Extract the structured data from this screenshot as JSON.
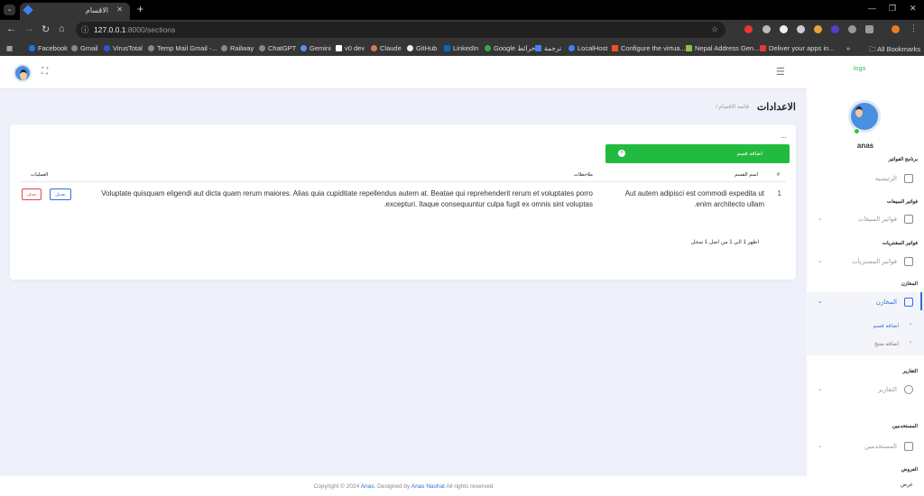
{
  "browser": {
    "tab_title": "الاقسام",
    "url_host": "127.0.0.1",
    "url_path": ":8000/sections",
    "bookmarks": [
      "Facebook",
      "Gmail",
      "VirusTotal",
      "Temp Mail Gmail -...",
      "Railway",
      "ChatGPT",
      "Gemini",
      "v0 dev",
      "Claude",
      "GitHub",
      "LinkedIn",
      "Google خرائط",
      "ترجمة",
      "LocalHost",
      "Configure the virtua...",
      "Nepal Address Gen...",
      "Deliver your apps in...",
      "»",
      "All Bookmarks"
    ]
  },
  "sidebar": {
    "logo_alt": "logo",
    "username": "anas",
    "sections": [
      {
        "title": "برنامج الفواتير",
        "item": "الرئيسيه"
      },
      {
        "title": "فواتير المبيعات",
        "item": "فواتير المبيعات"
      },
      {
        "title": "فواتير المشتريات",
        "item": "فواتير المشتريات"
      },
      {
        "title": "المخازن",
        "item": "المخازن",
        "sub": [
          "اضافه قسم",
          "اضافه منتج"
        ]
      },
      {
        "title": "التقارير",
        "item": "التقارير"
      },
      {
        "title": "المستخدمين",
        "item": "المستخدمين"
      },
      {
        "title": "العروض",
        "item": "عرض"
      }
    ]
  },
  "page": {
    "title": "الاعدادات",
    "breadcrumb": "/ قائمه الاقسام",
    "menu_dots": "...",
    "add_button": "اضافه قسم",
    "table": {
      "headers": [
        "#",
        "اسم القسم",
        "ملاحظات",
        "العمليات"
      ],
      "rows": [
        {
          "num": "1",
          "name": "Aut autem adipisci est commodi expedita ut enim architecto ullam.",
          "notes": "Voluptate quisquam eligendi aut dicta quam rerum maiores. Alias quia cupiditate repellendus autem at. Beatae qui reprehenderit rerum et voluptates porro excepturi. Itaque consequuntur culpa fugit ex omnis sint voluptas.",
          "edit": "تعديل",
          "delete": "حذف"
        }
      ]
    },
    "pagination_info": "اظهر 1 الي 1 من اصل 1 سجل"
  },
  "footer": {
    "prefix": "Copyright © 2024",
    "author": "Anas.",
    "middle": "Designed by",
    "designer": "Anas Nashat",
    "suffix": "All rights reserved"
  },
  "colors": {
    "accent": "#2f6fe0",
    "success": "#22bb3f",
    "danger": "#e0454f"
  }
}
